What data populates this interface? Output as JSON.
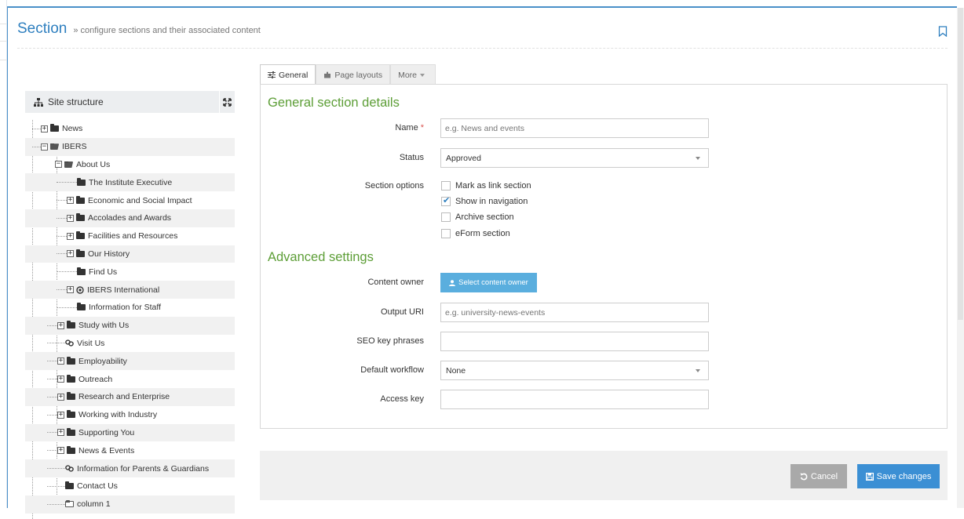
{
  "header": {
    "title": "Section",
    "subtitle": "» configure sections and their associated content"
  },
  "tree": {
    "title": "Site structure",
    "items": [
      {
        "label": "News",
        "expander": "+",
        "icon": "folder-icon"
      },
      {
        "label": "IBERS",
        "expander": "−",
        "icon": "folder-open-icon"
      },
      {
        "label": "About Us",
        "expander": "−",
        "icon": "folder-open-icon"
      },
      {
        "label": "The Institute Executive",
        "expander": "",
        "icon": "folder-icon"
      },
      {
        "label": "Economic and Social Impact",
        "expander": "+",
        "icon": "folder-icon"
      },
      {
        "label": "Accolades and Awards",
        "expander": "+",
        "icon": "folder-icon"
      },
      {
        "label": "Facilities and Resources",
        "expander": "+",
        "icon": "folder-icon"
      },
      {
        "label": "Our History",
        "expander": "+",
        "icon": "folder-icon"
      },
      {
        "label": "Find Us",
        "expander": "",
        "icon": "folder-icon"
      },
      {
        "label": "IBERS International",
        "expander": "+",
        "icon": "target-icon"
      },
      {
        "label": "Information for Staff",
        "expander": "",
        "icon": "folder-icon"
      },
      {
        "label": "Study with Us",
        "expander": "+",
        "icon": "folder-icon"
      },
      {
        "label": "Visit Us",
        "expander": "",
        "icon": "link-icon"
      },
      {
        "label": "Employability",
        "expander": "+",
        "icon": "folder-icon"
      },
      {
        "label": "Outreach",
        "expander": "+",
        "icon": "folder-icon"
      },
      {
        "label": "Research and Enterprise",
        "expander": "+",
        "icon": "folder-icon"
      },
      {
        "label": "Working with Industry",
        "expander": "+",
        "icon": "folder-icon"
      },
      {
        "label": "Supporting You",
        "expander": "+",
        "icon": "folder-icon"
      },
      {
        "label": "News & Events",
        "expander": "+",
        "icon": "folder-icon"
      },
      {
        "label": "Information for Parents & Guardians",
        "expander": "",
        "icon": "link-icon"
      },
      {
        "label": "Contact Us",
        "expander": "",
        "icon": "folder-icon"
      },
      {
        "label": "column 1",
        "expander": "",
        "icon": "folder-outline-icon"
      }
    ]
  },
  "tabs": [
    {
      "label": "General",
      "icon": "sliders-icon",
      "active": true
    },
    {
      "label": "Page layouts",
      "icon": "puzzle-icon",
      "active": false
    },
    {
      "label": "More",
      "icon": "caret-down-icon",
      "active": false
    }
  ],
  "general": {
    "title": "General section details",
    "name_label": "Name",
    "name_required": "*",
    "name_placeholder": "e.g. News and events",
    "status_label": "Status",
    "status_value": "Approved",
    "options_label": "Section options",
    "options": [
      {
        "label": "Mark as link section",
        "checked": false
      },
      {
        "label": "Show in navigation",
        "checked": true
      },
      {
        "label": "Archive section",
        "checked": false
      },
      {
        "label": "eForm section",
        "checked": false
      }
    ]
  },
  "advanced": {
    "title": "Advanced settings",
    "owner_label": "Content owner",
    "owner_button": "Select content owner",
    "uri_label": "Output URI",
    "uri_placeholder": "e.g. university-news-events",
    "seo_label": "SEO key phrases",
    "seo_value": "",
    "workflow_label": "Default workflow",
    "workflow_value": "None",
    "access_label": "Access key",
    "access_value": ""
  },
  "footer": {
    "cancel_label": "Cancel",
    "save_label": "Save changes"
  },
  "colors": {
    "accent": "#2e7fbf",
    "section_title": "#5d9e37",
    "save": "#3b8fd4",
    "cancel": "#a9a9a9",
    "owner_button": "#5aaede"
  }
}
